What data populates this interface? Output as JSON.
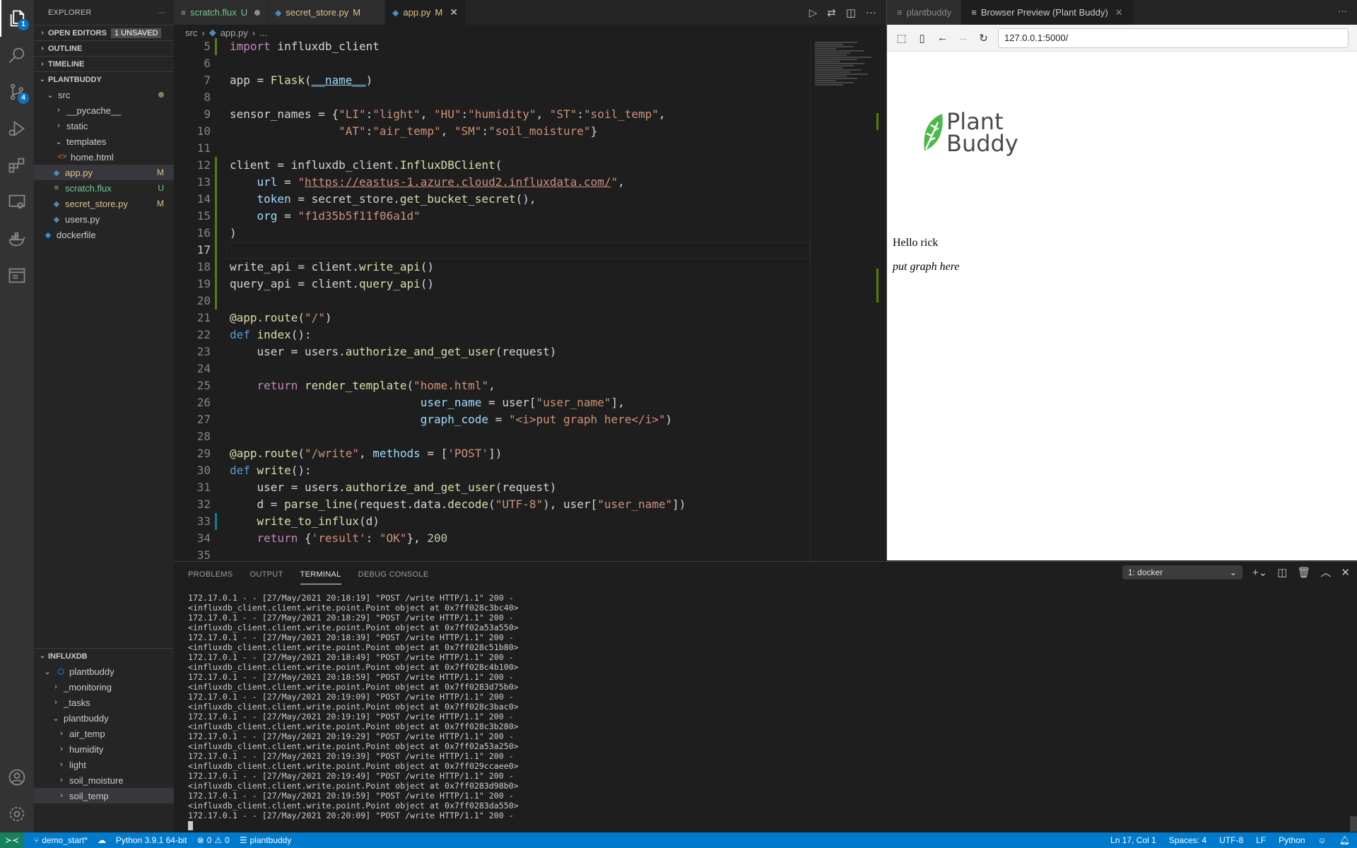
{
  "activity_bar": {
    "items": [
      {
        "name": "explorer",
        "badge": "1",
        "active": true
      },
      {
        "name": "search",
        "badge": null
      },
      {
        "name": "source-control",
        "badge": "4"
      },
      {
        "name": "run-debug",
        "badge": null
      },
      {
        "name": "extensions",
        "badge": null
      },
      {
        "name": "remote-explorer",
        "badge": null
      },
      {
        "name": "docker",
        "badge": null
      },
      {
        "name": "browser-preview",
        "badge": null
      }
    ],
    "bottom": [
      "accounts",
      "manage"
    ]
  },
  "sidebar": {
    "title": "EXPLORER",
    "more": "···",
    "open_editors": {
      "label": "OPEN EDITORS",
      "badge": "1 UNSAVED"
    },
    "outline": "OUTLINE",
    "timeline": "TIMELINE",
    "project": "PLANTBUDDY",
    "tree": [
      {
        "label": "src",
        "type": "folder-open",
        "depth": 1,
        "status": "dot"
      },
      {
        "label": "__pycache__",
        "type": "folder",
        "depth": 2
      },
      {
        "label": "static",
        "type": "folder",
        "depth": 2
      },
      {
        "label": "templates",
        "type": "folder-open",
        "depth": 2
      },
      {
        "label": "home.html",
        "type": "html",
        "depth": 3
      },
      {
        "label": "app.py",
        "type": "python",
        "depth": 2,
        "status": "M",
        "selected": true
      },
      {
        "label": "scratch.flux",
        "type": "text",
        "depth": 2,
        "status": "U"
      },
      {
        "label": "secret_store.py",
        "type": "python",
        "depth": 2,
        "status": "M"
      },
      {
        "label": "users.py",
        "type": "python",
        "depth": 2
      },
      {
        "label": "dockerfile",
        "type": "docker",
        "depth": 1
      }
    ],
    "influxdb": {
      "label": "INFLUXDB",
      "connection": "plantbuddy",
      "items": [
        {
          "label": "_monitoring",
          "depth": 2
        },
        {
          "label": "_tasks",
          "depth": 2
        },
        {
          "label": "plantbuddy",
          "depth": 2,
          "open": true
        },
        {
          "label": "air_temp",
          "depth": 3
        },
        {
          "label": "humidity",
          "depth": 3
        },
        {
          "label": "light",
          "depth": 3
        },
        {
          "label": "soil_moisture",
          "depth": 3
        },
        {
          "label": "soil_temp",
          "depth": 3,
          "selected": true
        }
      ]
    }
  },
  "editor": {
    "tabs": [
      {
        "label": "scratch.flux",
        "status": "U",
        "dirty": true,
        "icon": "text"
      },
      {
        "label": "secret_store.py",
        "status": "M",
        "icon": "python"
      },
      {
        "label": "app.py",
        "status": "M",
        "icon": "python",
        "active": true
      }
    ],
    "breadcrumb": [
      "src",
      "app.py",
      "..."
    ],
    "current_line": 17,
    "lines": [
      {
        "n": 5,
        "g": "add"
      },
      {
        "n": 6
      },
      {
        "n": 7
      },
      {
        "n": 8
      },
      {
        "n": 9
      },
      {
        "n": 10
      },
      {
        "n": 11
      },
      {
        "n": 12,
        "g": "add"
      },
      {
        "n": 13,
        "g": "add"
      },
      {
        "n": 14,
        "g": "add"
      },
      {
        "n": 15,
        "g": "add"
      },
      {
        "n": 16,
        "g": "add"
      },
      {
        "n": 17,
        "g": "add"
      },
      {
        "n": 18,
        "g": "add"
      },
      {
        "n": 19,
        "g": "add"
      },
      {
        "n": 20,
        "g": "add"
      },
      {
        "n": 21
      },
      {
        "n": 22
      },
      {
        "n": 23
      },
      {
        "n": 24
      },
      {
        "n": 25
      },
      {
        "n": 26
      },
      {
        "n": 27
      },
      {
        "n": 28
      },
      {
        "n": 29
      },
      {
        "n": 30
      },
      {
        "n": 31
      },
      {
        "n": 32
      },
      {
        "n": 33,
        "g": "mod"
      },
      {
        "n": 34
      },
      {
        "n": 35
      }
    ],
    "code": {
      "l5": "import influxdb_client",
      "l7": "app = Flask(__name__)",
      "l9": "sensor_names = {\"LI\":\"light\", \"HU\":\"humidity\", \"ST\":\"soil_temp\",",
      "l10": "\"AT\":\"air_temp\", \"SM\":\"soil_moisture\"}",
      "l12": "client = influxdb_client.InfluxDBClient(",
      "l13_url": "https://eastus-1.azure.cloud2.influxdata.com/",
      "l14": "token = secret_store.get_bucket_secret(),",
      "l15_org": "f1d35b5f11f06a1d",
      "l16": ")",
      "l18": "write_api = client.write_api()",
      "l19": "query_api = client.query_api()",
      "l21": "@app.route(\"/\")",
      "l22": "def index():",
      "l23": "user = users.authorize_and_get_user(request)",
      "l25": "return render_template(\"home.html\",",
      "l26": "user_name = user[\"user_name\"],",
      "l27": "graph_code = \"<i>put graph here</i>\")",
      "l29": "@app.route(\"/write\", methods = ['POST'])",
      "l30": "def write():",
      "l31": "user = users.authorize_and_get_user(request)",
      "l32": "d = parse_line(request.data.decode(\"UTF-8\"), user[\"user_name\"])",
      "l33": "write_to_influx(d)",
      "l34": "return {'result': \"OK\"}, 200"
    }
  },
  "browser_preview": {
    "tabs": [
      {
        "label": "plantbuddy",
        "active": false
      },
      {
        "label": "Browser Preview (Plant Buddy)",
        "active": true
      }
    ],
    "url": "127.0.0.1:5000/",
    "logo_line1": "Plant",
    "logo_line2": "Buddy",
    "hello": "Hello rick",
    "graph_placeholder": "put graph here",
    "brand_green": "#4cb84c"
  },
  "panel": {
    "tabs": [
      "PROBLEMS",
      "OUTPUT",
      "TERMINAL",
      "DEBUG CONSOLE"
    ],
    "active_tab": "TERMINAL",
    "terminal_select": "1: docker",
    "terminal_lines": [
      "172.17.0.1 - - [27/May/2021 20:18:19] \"POST /write HTTP/1.1\" 200 -",
      "<influxdb_client.client.write.point.Point object at 0x7ff028c3bc40>",
      "172.17.0.1 - - [27/May/2021 20:18:29] \"POST /write HTTP/1.1\" 200 -",
      "<influxdb_client.client.write.point.Point object at 0x7ff02a53a550>",
      "172.17.0.1 - - [27/May/2021 20:18:39] \"POST /write HTTP/1.1\" 200 -",
      "<influxdb_client.client.write.point.Point object at 0x7ff028c51b80>",
      "172.17.0.1 - - [27/May/2021 20:18:49] \"POST /write HTTP/1.1\" 200 -",
      "<influxdb_client.client.write.point.Point object at 0x7ff028c4b100>",
      "172.17.0.1 - - [27/May/2021 20:18:59] \"POST /write HTTP/1.1\" 200 -",
      "<influxdb_client.client.write.point.Point object at 0x7ff0283d75b0>",
      "172.17.0.1 - - [27/May/2021 20:19:09] \"POST /write HTTP/1.1\" 200 -",
      "<influxdb_client.client.write.point.Point object at 0x7ff028c3bac0>",
      "172.17.0.1 - - [27/May/2021 20:19:19] \"POST /write HTTP/1.1\" 200 -",
      "<influxdb_client.client.write.point.Point object at 0x7ff028c3b280>",
      "172.17.0.1 - - [27/May/2021 20:19:29] \"POST /write HTTP/1.1\" 200 -",
      "<influxdb_client.client.write.point.Point object at 0x7ff02a53a250>",
      "172.17.0.1 - - [27/May/2021 20:19:39] \"POST /write HTTP/1.1\" 200 -",
      "<influxdb_client.client.write.point.Point object at 0x7ff029ccaee0>",
      "172.17.0.1 - - [27/May/2021 20:19:49] \"POST /write HTTP/1.1\" 200 -",
      "<influxdb_client.client.write.point.Point object at 0x7ff0283d98b0>",
      "172.17.0.1 - - [27/May/2021 20:19:59] \"POST /write HTTP/1.1\" 200 -",
      "<influxdb_client.client.write.point.Point object at 0x7ff0283da550>",
      "172.17.0.1 - - [27/May/2021 20:20:09] \"POST /write HTTP/1.1\" 200 -"
    ]
  },
  "status_bar": {
    "branch": "demo_start*",
    "interpreter": "Python 3.9.1 64-bit",
    "errors": "0",
    "warnings": "0",
    "workspace": "plantbuddy",
    "position": "Ln 17, Col 1",
    "indent": "Spaces: 4",
    "encoding": "UTF-8",
    "eol": "LF",
    "language": "Python",
    "colors": {
      "bar": "#007acc",
      "remote": "#16825d"
    }
  }
}
